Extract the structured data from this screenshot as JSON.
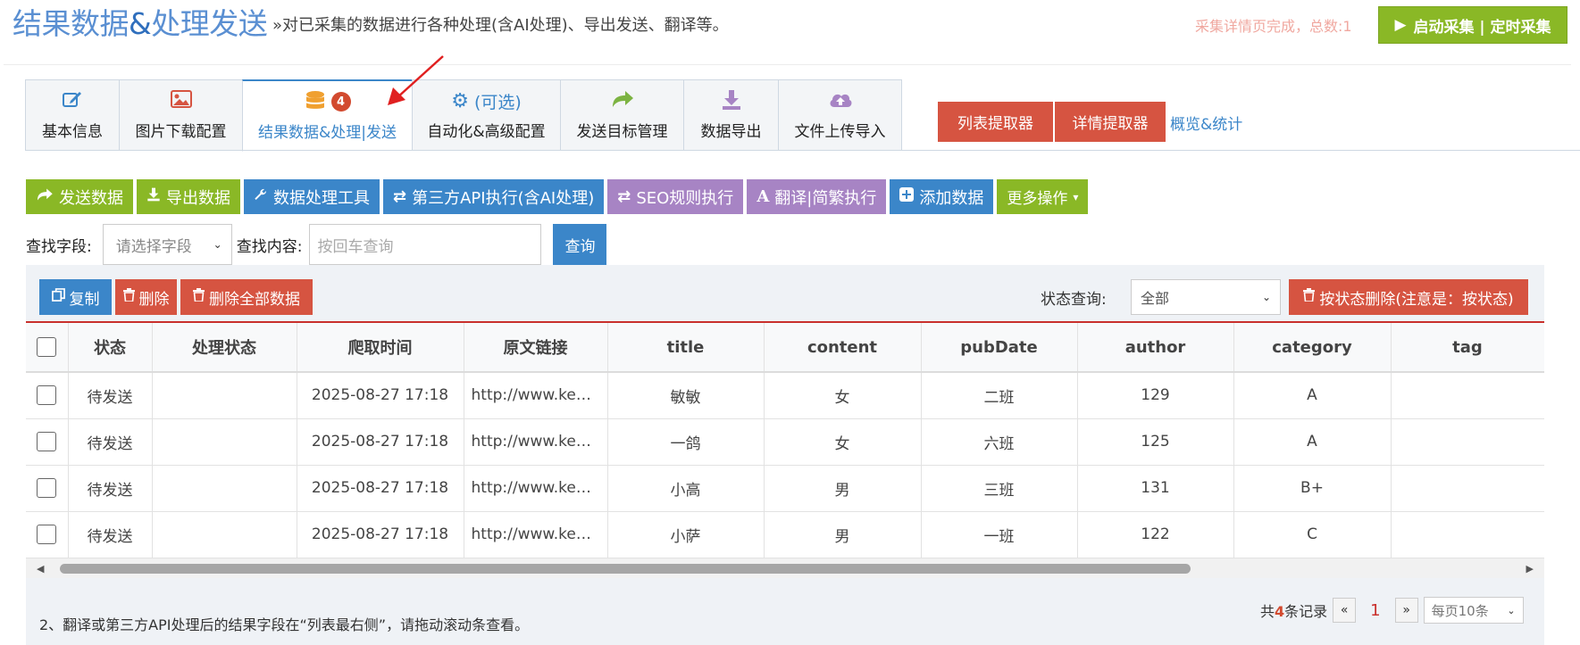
{
  "header": {
    "title_part1": "结果数据",
    "title_amp": "&",
    "title_part2": "处理发送",
    "subtitle": "»对已采集的数据进行各种处理(含AI处理)、导出发送、翻译等。",
    "status": "采集详情页完成，总数:1",
    "start_button": "启动采集 | 定时采集"
  },
  "tabs": [
    {
      "label": "基本信息",
      "icon": "edit-icon"
    },
    {
      "label": "图片下载配置",
      "icon": "image-icon"
    },
    {
      "label": "结果数据&处理|发送",
      "icon": "database-icon",
      "badge": "4"
    },
    {
      "label": "自动化&高级配置",
      "icon": "gears-icon",
      "icon_text": "(可选)"
    },
    {
      "label": "发送目标管理",
      "icon": "share-icon"
    },
    {
      "label": "数据导出",
      "icon": "download-icon"
    },
    {
      "label": "文件上传导入",
      "icon": "cloud-upload-icon"
    }
  ],
  "extractors": {
    "list": "列表提取器",
    "detail": "详情提取器",
    "overview": "概览&统计"
  },
  "actions": {
    "send": "发送数据",
    "export": "导出数据",
    "tools": "数据处理工具",
    "third_api": "第三方API执行(含AI处理)",
    "seo": "SEO规则执行",
    "translate": "翻译|简繁执行",
    "add": "添加数据",
    "more": "更多操作"
  },
  "search": {
    "field_label": "查找字段:",
    "field_placeholder": "请选择字段",
    "content_label": "查找内容:",
    "content_placeholder": "按回车查询",
    "button": "查询"
  },
  "toolbar": {
    "copy": "复制",
    "delete": "删除",
    "delete_all": "删除全部数据",
    "status_label": "状态查询:",
    "status_value": "全部",
    "delete_by_status": "按状态删除(注意是：按状态)"
  },
  "table": {
    "headers": [
      "状态",
      "处理状态",
      "爬取时间",
      "原文链接",
      "title",
      "content",
      "pubDate",
      "author",
      "category",
      "tag"
    ],
    "rows": [
      [
        "待发送",
        "",
        "2025-08-27 17:18",
        "http://www.ke…",
        "敏敏",
        "女",
        "二班",
        "129",
        "A",
        ""
      ],
      [
        "待发送",
        "",
        "2025-08-27 17:18",
        "http://www.ke…",
        "一鸽",
        "女",
        "六班",
        "125",
        "A",
        ""
      ],
      [
        "待发送",
        "",
        "2025-08-27 17:18",
        "http://www.ke…",
        "小高",
        "男",
        "三班",
        "131",
        "B+",
        ""
      ],
      [
        "待发送",
        "",
        "2025-08-27 17:18",
        "http://www.ke…",
        "小萨",
        "男",
        "一班",
        "122",
        "C",
        ""
      ]
    ]
  },
  "footer": {
    "note": "2、翻译或第三方API处理后的结果字段在“列表最右侧”，请拖动滚动条查看。",
    "total_prefix": "共",
    "total_count": "4",
    "total_suffix": "条记录",
    "prev": "«",
    "current_page": "1",
    "next": "»",
    "page_size": "每页10条"
  },
  "colors": {
    "accent_blue": "#3b86c9",
    "green": "#8ab826",
    "red": "#d65441",
    "purple": "#a784c4"
  }
}
